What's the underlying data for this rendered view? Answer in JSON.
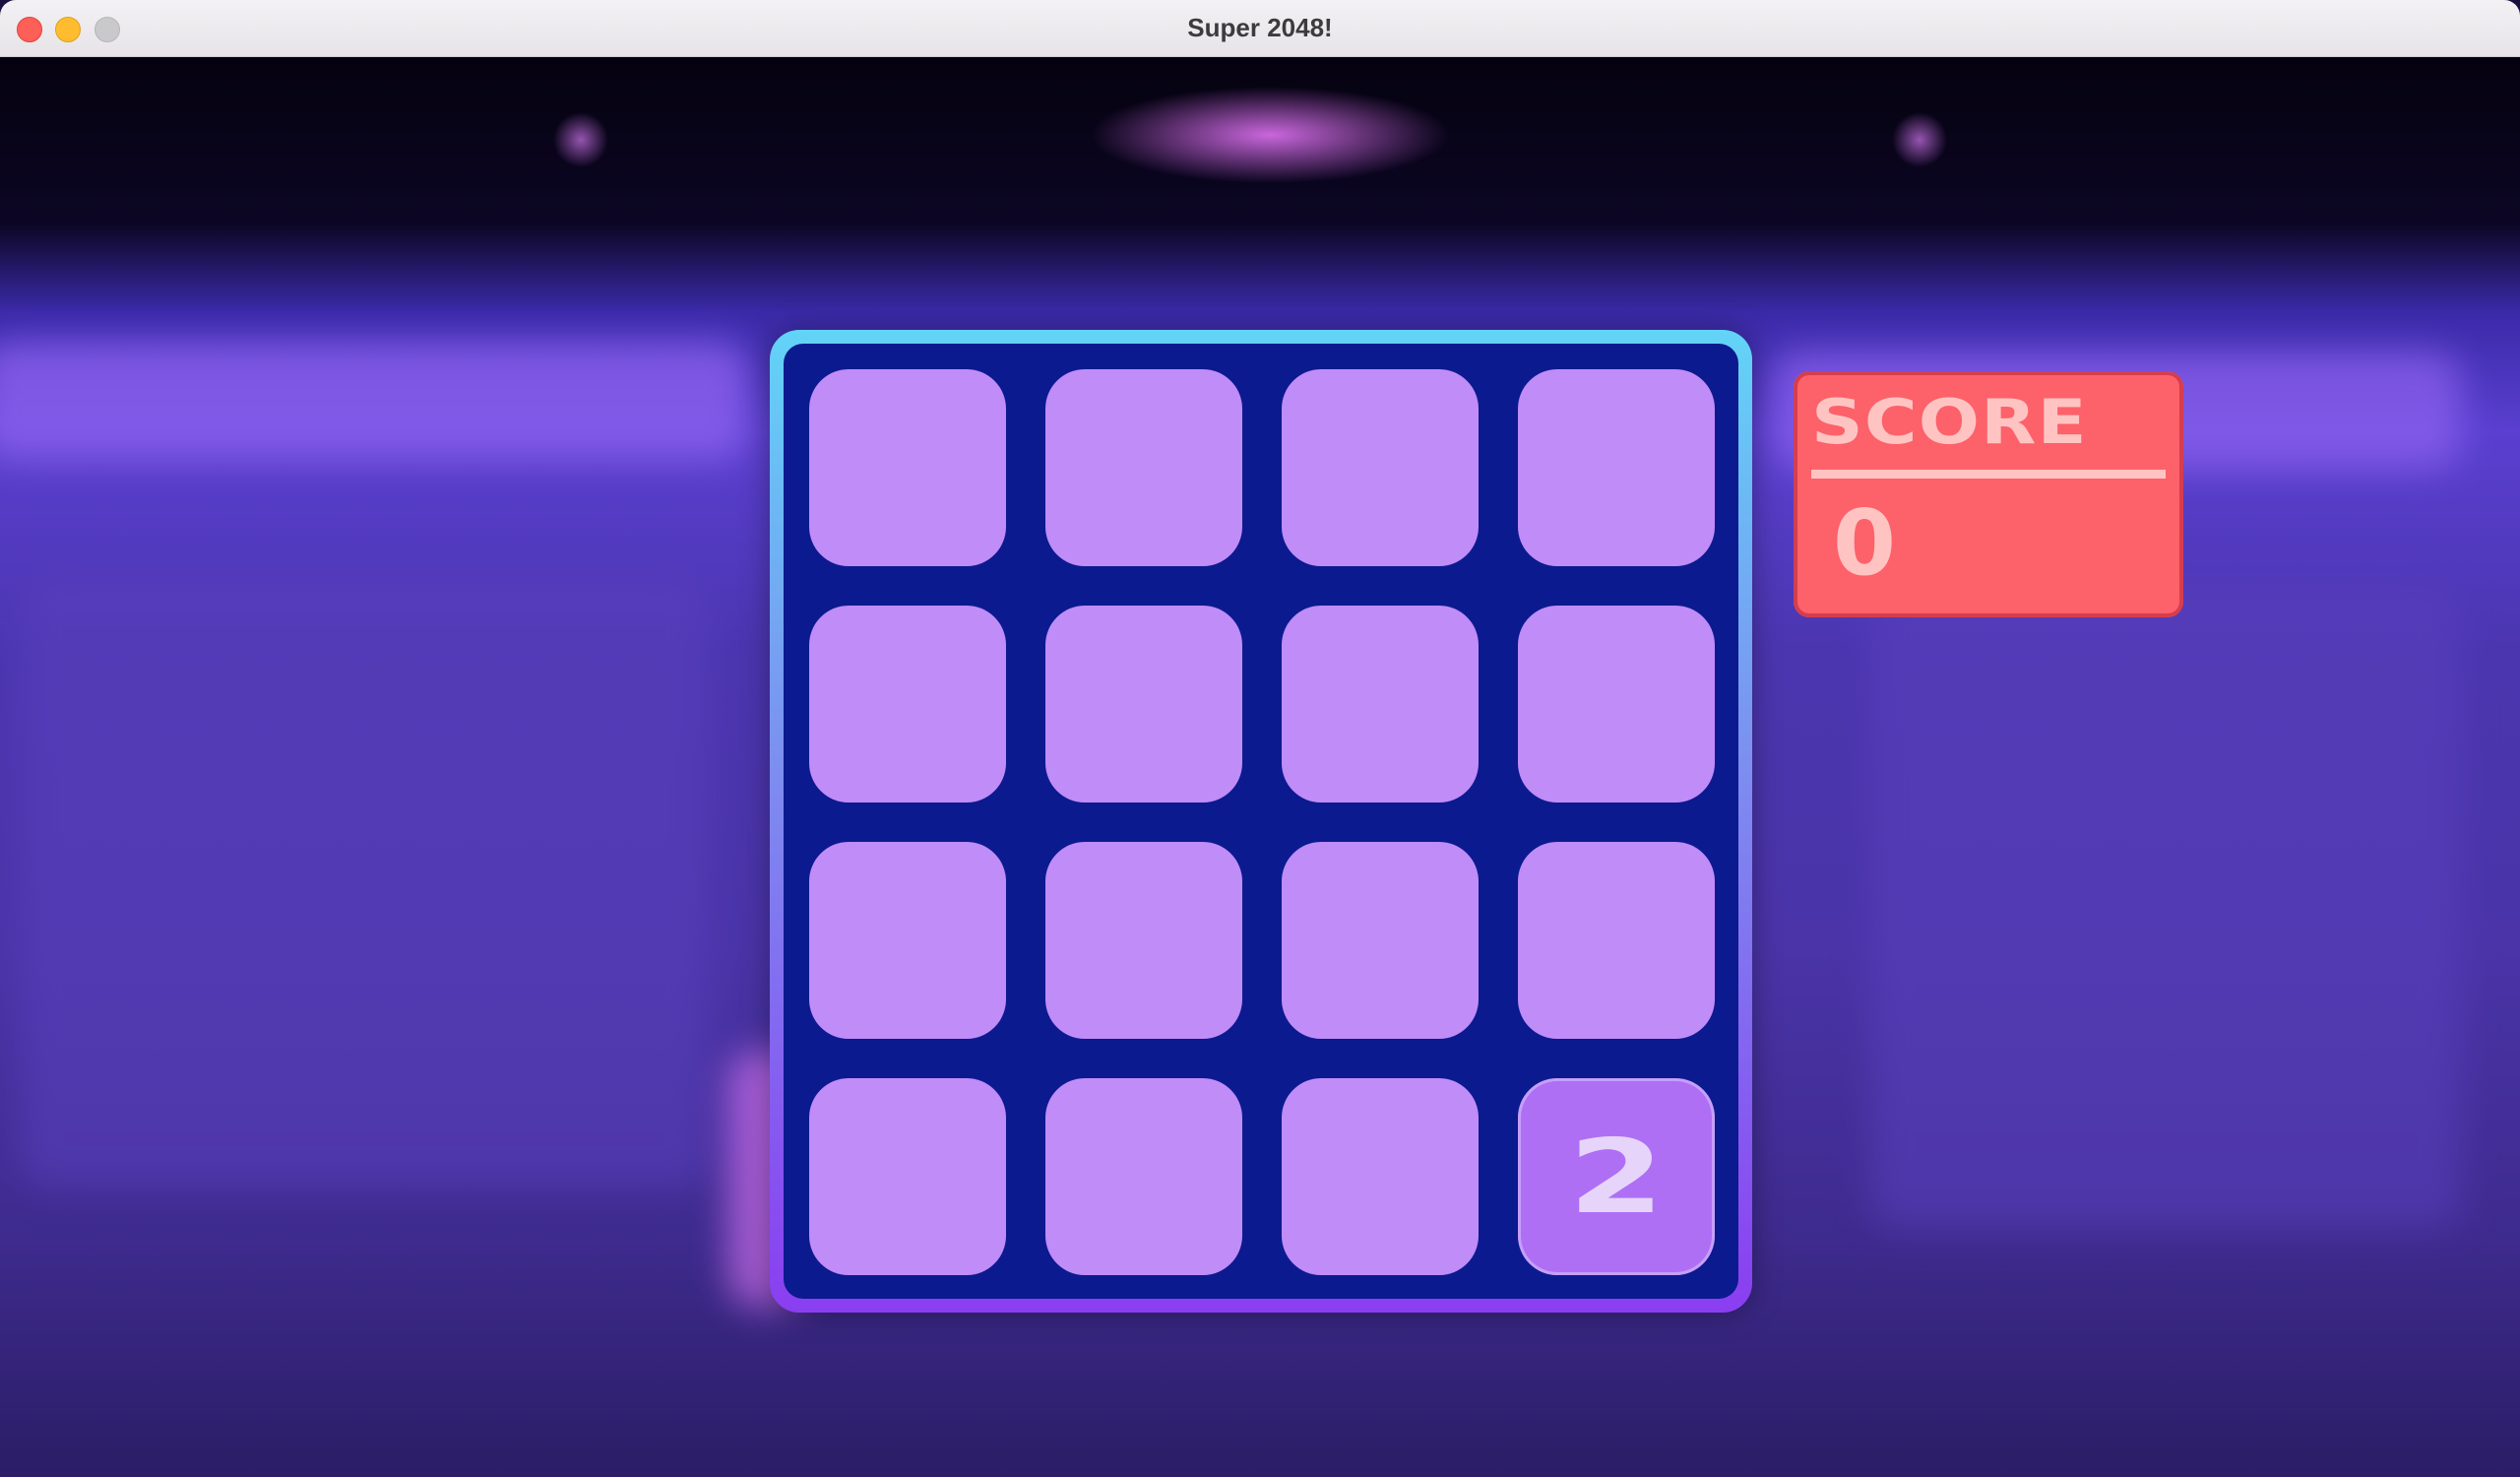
{
  "window": {
    "title": "Super 2048!"
  },
  "board": {
    "size": 4,
    "tiles": [
      [
        "",
        "",
        "",
        ""
      ],
      [
        "",
        "",
        "",
        ""
      ],
      [
        "",
        "",
        "",
        ""
      ],
      [
        "",
        "",
        "",
        "2"
      ]
    ]
  },
  "score": {
    "label": "SCORE",
    "value": "0"
  },
  "colors": {
    "board_background": "#0c1a8f",
    "board_border_top": "#62d4f7",
    "board_border_bottom": "#8a3ef0",
    "empty_tile": "#c08cf8",
    "tile_2": "#ae6ff5",
    "score_background": "#fd616a",
    "score_text": "#ffc4c2"
  }
}
